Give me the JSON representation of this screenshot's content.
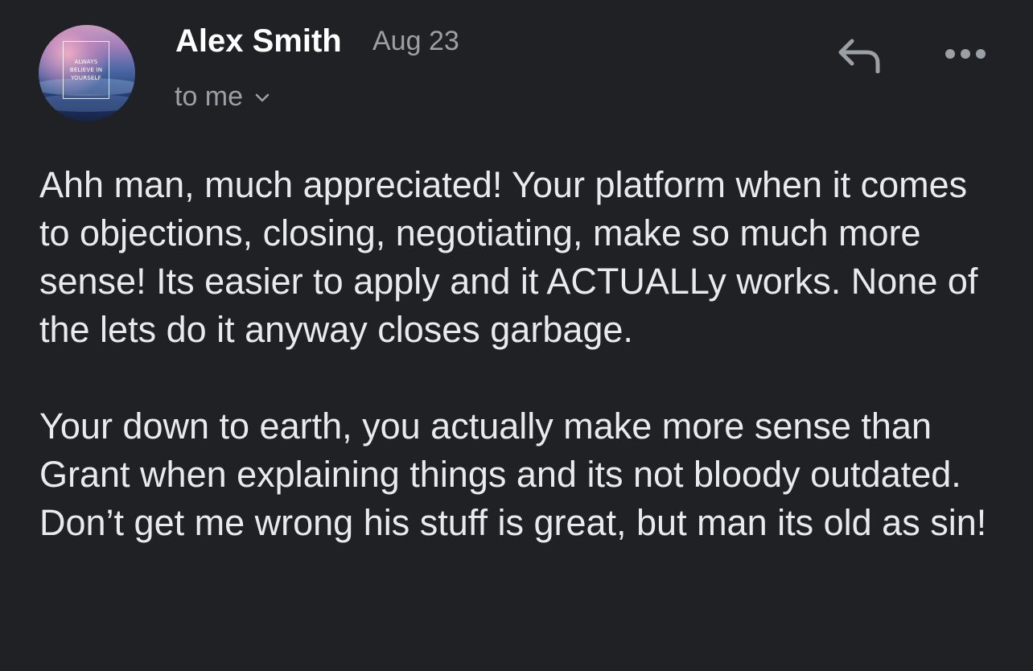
{
  "sender": {
    "name": "Alex Smith",
    "date": "Aug 23",
    "recipient": "to me",
    "avatar": {
      "quote": "ALWAYS\nBELIEVE IN\nYOURSELF"
    }
  },
  "actions": {
    "reply_icon": "reply-arrow",
    "more_icon": "three-dots-horizontal"
  },
  "message": {
    "paragraphs": [
      "Ahh man, much appreciated! Your platform when it comes to objections, closing, negotiating, make so much more sense! Its easier to apply and it ACTUALLy works. None of the lets do it anyway closes garbage.",
      "Your down to earth, you actually make more sense than Grant when explaining things and its not bloody outdated. Don’t get me wrong his stuff is great, but man its old as sin!"
    ]
  },
  "colors": {
    "background": "#202124",
    "name_text": "#ffffff",
    "secondary_text": "#9aa0a6",
    "body_text": "#e8eaed"
  }
}
